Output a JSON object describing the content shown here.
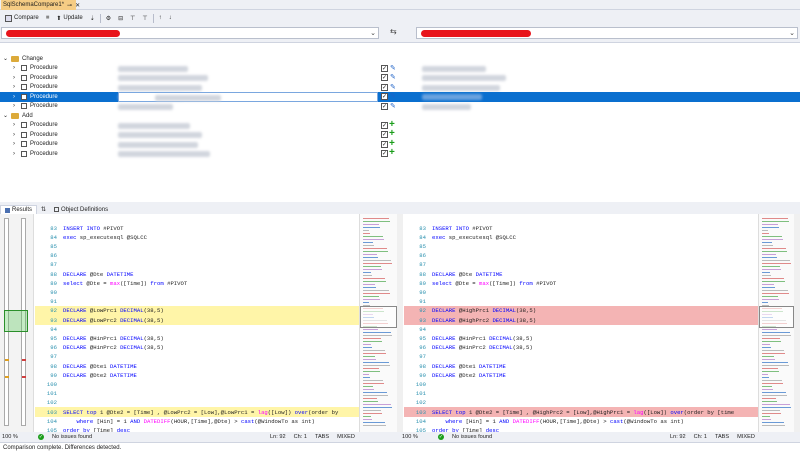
{
  "tab": {
    "title": "SqlSchemaCompare1*",
    "pin": "⊸",
    "close": "✕"
  },
  "toolbar": {
    "compare": "Compare",
    "stop": "■",
    "update": "Update",
    "update_icon": "⬆",
    "script_icon": "⇣",
    "options_icon": "⚙",
    "group_icon": "⊟",
    "filter_icon": "⊤",
    "filter2_icon": "⊤",
    "up_icon": "↑",
    "down_icon": "↓"
  },
  "source": {
    "chevron": "⌄"
  },
  "target": {
    "chevron": "⌄"
  },
  "swap_icon": "⇆",
  "tree": {
    "groups": [
      {
        "label": "Change",
        "expand": "⌄",
        "rows": [
          {
            "type": "Procedure",
            "checked": true,
            "action": "edit",
            "selected": false
          },
          {
            "type": "Procedure",
            "checked": true,
            "action": "edit",
            "selected": false
          },
          {
            "type": "Procedure",
            "checked": true,
            "action": "edit",
            "selected": false
          },
          {
            "type": "Procedure",
            "checked": true,
            "action": "edit",
            "selected": true
          },
          {
            "type": "Procedure",
            "checked": true,
            "action": "edit",
            "selected": false
          }
        ]
      },
      {
        "label": "Add",
        "expand": "⌄",
        "rows": [
          {
            "type": "Procedure",
            "checked": true,
            "action": "add",
            "selected": false
          },
          {
            "type": "Procedure",
            "checked": true,
            "action": "add",
            "selected": false
          },
          {
            "type": "Procedure",
            "checked": true,
            "action": "add",
            "selected": false
          },
          {
            "type": "Procedure",
            "checked": true,
            "action": "add",
            "selected": false
          }
        ]
      }
    ],
    "row_expand": "›",
    "check_mark": "✓",
    "edit_icon": "✎",
    "add_icon": "+"
  },
  "bottom_tabs": {
    "results": "Results",
    "obj_defs": "Object Definitions",
    "sync_icon": "⇅"
  },
  "left_code": [
    {
      "n": "83",
      "t": [
        [
          "kw",
          "INSERT INTO "
        ],
        [
          "",
          "#PIVOT"
        ]
      ]
    },
    {
      "n": "84",
      "t": [
        [
          "kw",
          "exec "
        ],
        [
          "",
          "sp_executesql @SQLCC"
        ]
      ]
    },
    {
      "n": "85",
      "t": []
    },
    {
      "n": "86",
      "t": []
    },
    {
      "n": "87",
      "t": []
    },
    {
      "n": "88",
      "t": [
        [
          "kw",
          "DECLARE "
        ],
        [
          "",
          "@Dte "
        ],
        [
          "kw",
          "DATETIME"
        ]
      ]
    },
    {
      "n": "89",
      "t": [
        [
          "kw",
          "select "
        ],
        [
          "",
          "@Dte = "
        ],
        [
          "fn",
          "max"
        ],
        [
          "",
          "([Time]) "
        ],
        [
          "kw",
          "from "
        ],
        [
          "",
          "#PIVOT"
        ]
      ]
    },
    {
      "n": "90",
      "t": []
    },
    {
      "n": "91",
      "t": []
    },
    {
      "n": "92",
      "hl": "Y",
      "t": [
        [
          "kw",
          "DECLARE "
        ],
        [
          "",
          "@LowPrc1 "
        ],
        [
          "kw",
          "DECIMAL"
        ],
        [
          "",
          "(38,5)"
        ]
      ]
    },
    {
      "n": "93",
      "hl": "Y",
      "t": [
        [
          "kw",
          "DECLARE "
        ],
        [
          "",
          "@LowPrc2 "
        ],
        [
          "kw",
          "DECIMAL"
        ],
        [
          "",
          "(38,5)"
        ]
      ]
    },
    {
      "n": "94",
      "t": []
    },
    {
      "n": "95",
      "t": [
        [
          "kw",
          "DECLARE "
        ],
        [
          "",
          "@HinPrc1 "
        ],
        [
          "kw",
          "DECIMAL"
        ],
        [
          "",
          "(38,5)"
        ]
      ]
    },
    {
      "n": "96",
      "t": [
        [
          "kw",
          "DECLARE "
        ],
        [
          "",
          "@HinPrc2 "
        ],
        [
          "kw",
          "DECIMAL"
        ],
        [
          "",
          "(38,5)"
        ]
      ]
    },
    {
      "n": "97",
      "t": []
    },
    {
      "n": "98",
      "t": [
        [
          "kw",
          "DECLARE "
        ],
        [
          "",
          "@Dte1 "
        ],
        [
          "kw",
          "DATETIME"
        ]
      ]
    },
    {
      "n": "99",
      "t": [
        [
          "kw",
          "DECLARE "
        ],
        [
          "",
          "@Dte2 "
        ],
        [
          "kw",
          "DATETIME"
        ]
      ]
    },
    {
      "n": "100",
      "t": []
    },
    {
      "n": "101",
      "t": []
    },
    {
      "n": "102",
      "t": []
    },
    {
      "n": "103",
      "hl": "Y",
      "t": [
        [
          "kw",
          "SELECT top "
        ],
        [
          "",
          "1 @Dte2 = [Time] , @LowPrc2 = [Low],@LowPrc1 = "
        ],
        [
          "fn",
          "lag"
        ],
        [
          "",
          "([Low]) "
        ],
        [
          "kw",
          "over"
        ],
        [
          "",
          "(order by"
        ]
      ]
    },
    {
      "n": "104",
      "t": [
        [
          "",
          "    "
        ],
        [
          "kw",
          "where "
        ],
        [
          "",
          "[Hin] = 1 "
        ],
        [
          "kw",
          "AND "
        ],
        [
          "fn",
          "DATEDIFF"
        ],
        [
          "",
          "(HOUR,[Time],@Dte) > "
        ],
        [
          "kw",
          "cast"
        ],
        [
          "",
          "(@WindowTo as int)"
        ]
      ]
    },
    {
      "n": "105",
      "t": [
        [
          "kw",
          "order by "
        ],
        [
          "",
          "[Time] "
        ],
        [
          "kw",
          "desc"
        ]
      ]
    },
    {
      "n": "106",
      "t": []
    },
    {
      "n": "107",
      "t": []
    }
  ],
  "right_code": [
    {
      "n": "83",
      "t": [
        [
          "kw",
          "INSERT INTO "
        ],
        [
          "",
          "#PIVOT"
        ]
      ]
    },
    {
      "n": "84",
      "t": [
        [
          "kw",
          "exec "
        ],
        [
          "",
          "sp_executesql @SQLCC"
        ]
      ]
    },
    {
      "n": "85",
      "t": []
    },
    {
      "n": "86",
      "t": []
    },
    {
      "n": "87",
      "t": []
    },
    {
      "n": "88",
      "t": [
        [
          "kw",
          "DECLARE "
        ],
        [
          "",
          "@Dte "
        ],
        [
          "kw",
          "DATETIME"
        ]
      ]
    },
    {
      "n": "89",
      "t": [
        [
          "kw",
          "select "
        ],
        [
          "",
          "@Dte = "
        ],
        [
          "fn",
          "max"
        ],
        [
          "",
          "([Time]) "
        ],
        [
          "kw",
          "from "
        ],
        [
          "",
          "#PIVOT"
        ]
      ]
    },
    {
      "n": "90",
      "t": []
    },
    {
      "n": "91",
      "t": []
    },
    {
      "n": "92",
      "hl": "R",
      "t": [
        [
          "kw",
          "DECLARE "
        ],
        [
          "",
          "@HighPrc1 "
        ],
        [
          "kw",
          "DECIMAL"
        ],
        [
          "",
          "(38,5)"
        ]
      ]
    },
    {
      "n": "93",
      "hl": "R",
      "t": [
        [
          "kw",
          "DECLARE "
        ],
        [
          "",
          "@HighPrc2 "
        ],
        [
          "kw",
          "DECIMAL"
        ],
        [
          "",
          "(38,5)"
        ]
      ]
    },
    {
      "n": "94",
      "t": []
    },
    {
      "n": "95",
      "t": [
        [
          "kw",
          "DECLARE "
        ],
        [
          "",
          "@HinPrc1 "
        ],
        [
          "kw",
          "DECIMAL"
        ],
        [
          "",
          "(38,5)"
        ]
      ]
    },
    {
      "n": "96",
      "t": [
        [
          "kw",
          "DECLARE "
        ],
        [
          "",
          "@HinPrc2 "
        ],
        [
          "kw",
          "DECIMAL"
        ],
        [
          "",
          "(38,5)"
        ]
      ]
    },
    {
      "n": "97",
      "t": []
    },
    {
      "n": "98",
      "t": [
        [
          "kw",
          "DECLARE "
        ],
        [
          "",
          "@Dte1 "
        ],
        [
          "kw",
          "DATETIME"
        ]
      ]
    },
    {
      "n": "99",
      "t": [
        [
          "kw",
          "DECLARE "
        ],
        [
          "",
          "@Dte2 "
        ],
        [
          "kw",
          "DATETIME"
        ]
      ]
    },
    {
      "n": "100",
      "t": []
    },
    {
      "n": "101",
      "t": []
    },
    {
      "n": "102",
      "t": []
    },
    {
      "n": "103",
      "hl": "R",
      "t": [
        [
          "kw",
          "SELECT top "
        ],
        [
          "",
          "1 @Dte2 = [Time] , @HighPrc2 = [Low],@HighPrc1 = "
        ],
        [
          "fn",
          "lag"
        ],
        [
          "",
          "([Low]) "
        ],
        [
          "kw",
          "over"
        ],
        [
          "",
          "(order by [time"
        ]
      ]
    },
    {
      "n": "104",
      "t": [
        [
          "",
          "    "
        ],
        [
          "kw",
          "where "
        ],
        [
          "",
          "[Hin] = 1 "
        ],
        [
          "kw",
          "AND "
        ],
        [
          "fn",
          "DATEDIFF"
        ],
        [
          "",
          "(HOUR,[Time],@Dte) > "
        ],
        [
          "kw",
          "cast"
        ],
        [
          "",
          "(@WindowTo as int)"
        ]
      ]
    },
    {
      "n": "105",
      "t": [
        [
          "kw",
          "order by "
        ],
        [
          "",
          "[Time] "
        ],
        [
          "kw",
          "desc"
        ]
      ]
    },
    {
      "n": "106",
      "t": []
    },
    {
      "n": "107",
      "t": []
    }
  ],
  "status_left": {
    "zoom": "100 %",
    "issues": "No issues found",
    "ln": "Ln: 92",
    "ch": "Ch: 1",
    "tabs": "TABS",
    "mixed": "MIXED"
  },
  "status_right": {
    "zoom": "100 %",
    "issues": "No issues found",
    "ln": "Ln: 92",
    "ch": "Ch: 1",
    "tabs": "TABS",
    "mixed": "MIXED"
  },
  "status": {
    "text": "Comparison complete.  Differences detected."
  },
  "colors": {
    "selected": "#0a6fcf",
    "redact": "#e8141c",
    "diff_left": "#fff5a8",
    "diff_right": "#f4b4b4",
    "tab_active": "#f5cc84"
  }
}
